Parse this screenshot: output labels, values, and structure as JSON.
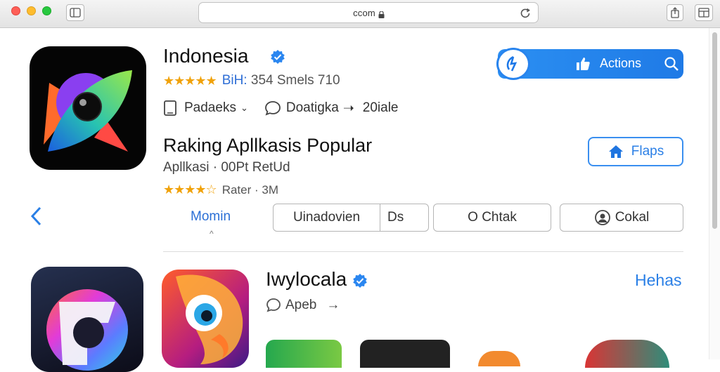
{
  "browser": {
    "url": "ccom",
    "icons": [
      "sidebar-icon",
      "lock-icon",
      "reload-icon",
      "share-icon",
      "tabs-icon"
    ]
  },
  "app": {
    "title": "Indonesia",
    "rating_stars": "★★★★★",
    "rating_prefix": "BiH:",
    "rating_text": "354 Smels 710",
    "info_item1": "Padaeks",
    "info_item2": "Doatigka",
    "info_item3": "20iale"
  },
  "action_bar": {
    "label": "Actions",
    "icons": [
      "app-logo-icon",
      "thumbs-up-icon",
      "search-icon"
    ]
  },
  "section": {
    "title": "Raking Apllkasis Popular",
    "subtitle": "Apllkasi · 00Pt RetUd",
    "rating_stars": "★★★★☆",
    "rating_text": "Rater · 3M",
    "flaps_label": "Flaps"
  },
  "tabs": {
    "active": "Momin",
    "caret": "^",
    "segment_a": "Uinadovien",
    "segment_b": "Ds",
    "check_label": "O Chtak",
    "cokal_label": "Cokal"
  },
  "app2": {
    "title": "Iwylocala",
    "sub": "Apeb",
    "link": "Hehas"
  },
  "colors": {
    "accent": "#2a7fe6",
    "star": "#f0a20b",
    "divider": "#dcdcdc"
  }
}
